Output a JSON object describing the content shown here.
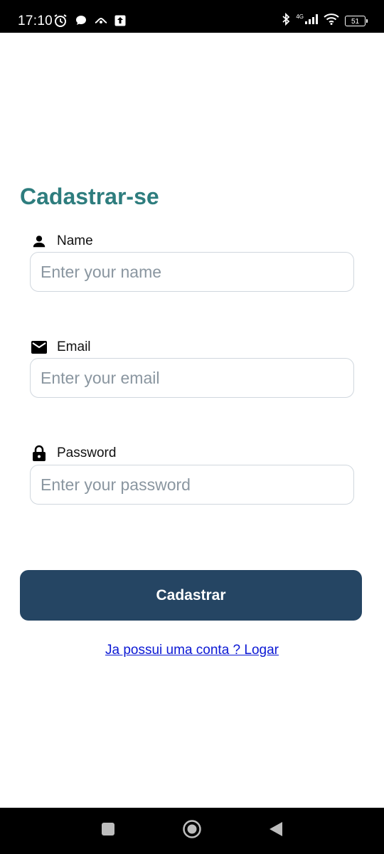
{
  "status_bar": {
    "time": "17:10",
    "network": "4G",
    "battery": "51",
    "icons": [
      "alarm-icon",
      "chat-icon",
      "shopee-icon",
      "upload-icon",
      "bluetooth-icon",
      "signal-icon",
      "wifi-icon",
      "battery-icon"
    ]
  },
  "form": {
    "title": "Cadastrar-se",
    "name": {
      "label": "Name",
      "placeholder": "Enter your name",
      "icon": "person-icon"
    },
    "email": {
      "label": "Email",
      "placeholder": "Enter your email",
      "icon": "mail-icon"
    },
    "password": {
      "label": "Password",
      "placeholder": "Enter your password",
      "icon": "lock-icon"
    },
    "submit_label": "Cadastrar",
    "login_link": "Ja possui uma conta ? Logar"
  },
  "nav_bar": {
    "icons": [
      "recent-apps-icon",
      "home-icon",
      "back-icon"
    ]
  },
  "colors": {
    "title": "#2e7d7e",
    "button_bg": "#254563",
    "link": "#0b18d4",
    "input_border": "#d0d7de"
  }
}
